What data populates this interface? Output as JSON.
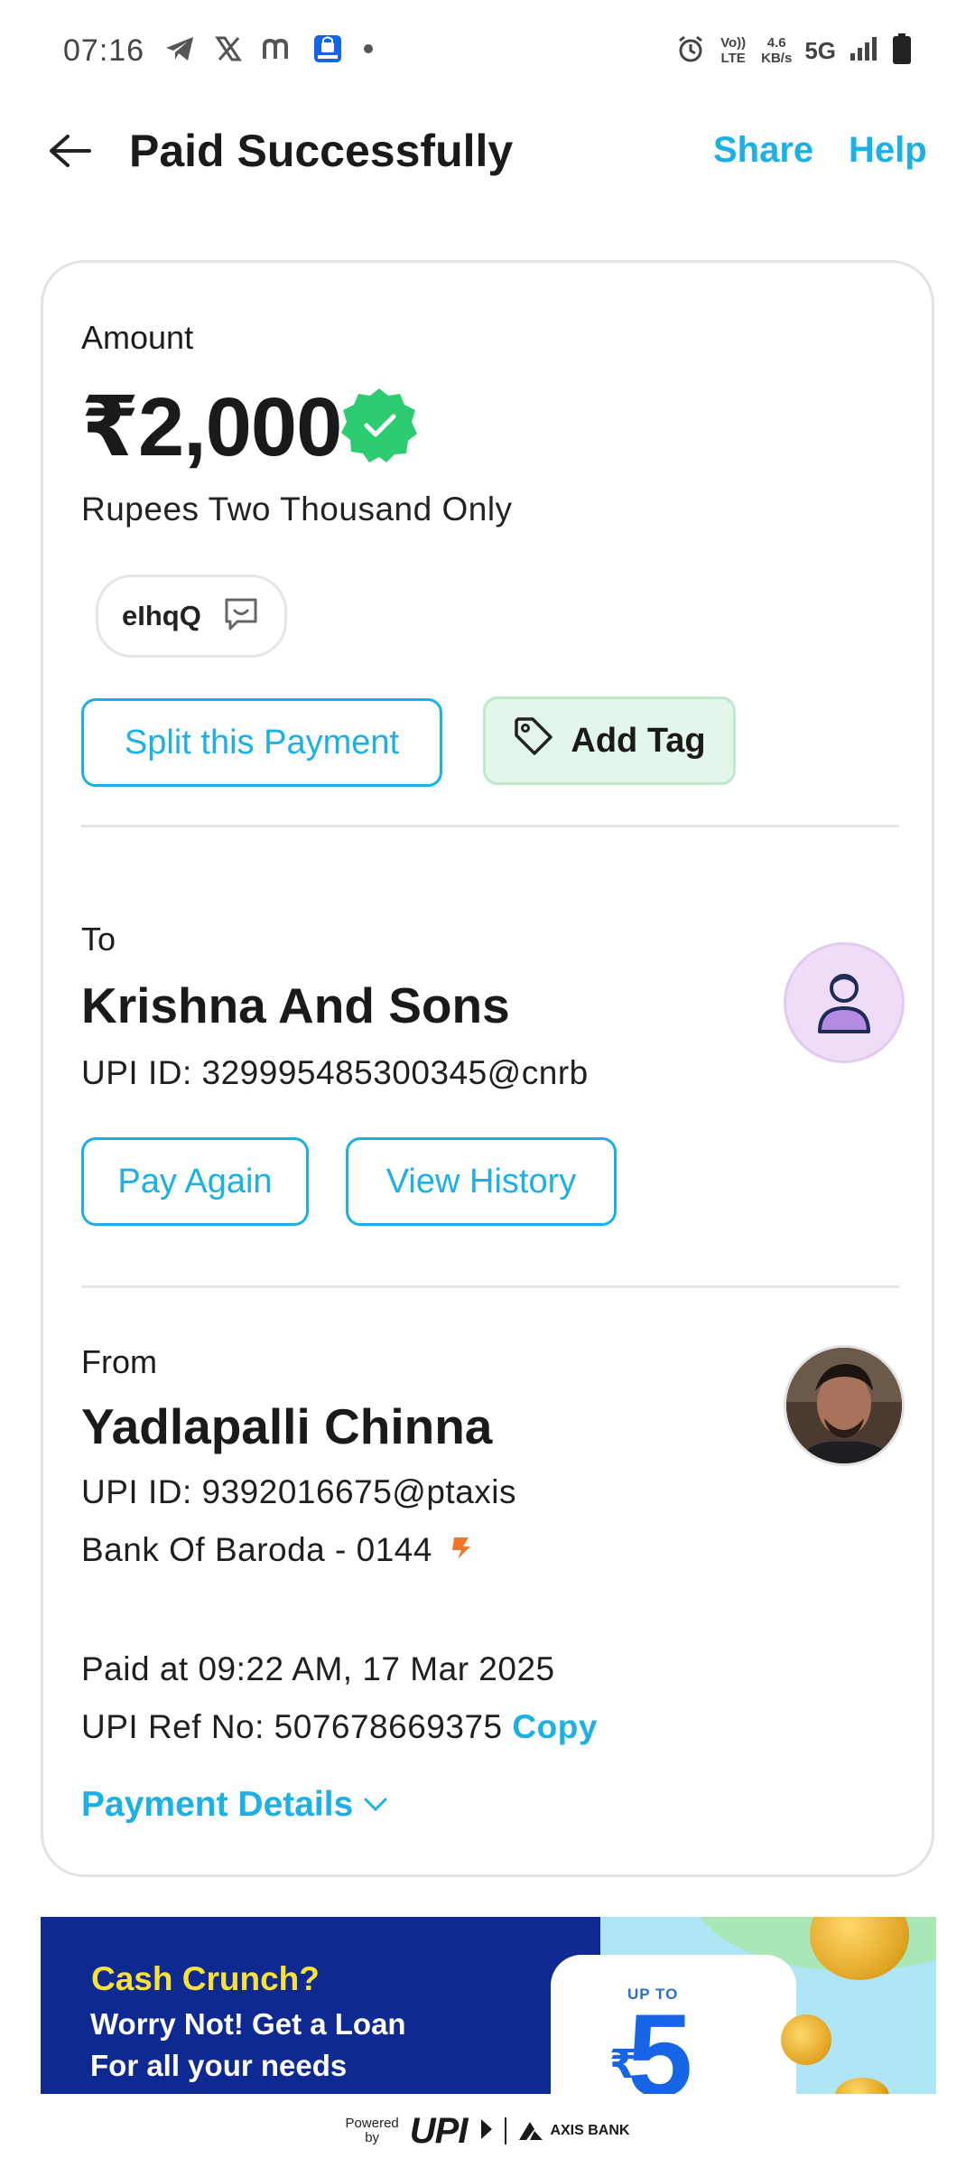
{
  "status_bar": {
    "time": "07:16",
    "network_speed_value": "4.6",
    "network_speed_unit": "KB/s",
    "volte": "Vo)) LTE",
    "network_type": "5G",
    "icons": [
      "telegram-icon",
      "x-icon",
      "m-app-icon",
      "lock-app-icon",
      "dot-icon",
      "alarm-icon",
      "signal-icon",
      "battery-icon"
    ]
  },
  "header": {
    "title": "Paid Successfully",
    "share_label": "Share",
    "help_label": "Help"
  },
  "amount_section": {
    "label": "Amount",
    "value": "₹2,000",
    "in_words": "Rupees Two Thousand Only",
    "note": "eIhqQ",
    "split_button": "Split this Payment",
    "tag_button": "Add Tag"
  },
  "to_section": {
    "label": "To",
    "name": "Krishna And Sons",
    "upi_id": "UPI ID: 329995485300345@cnrb",
    "pay_again_button": "Pay Again",
    "view_history_button": "View History"
  },
  "from_section": {
    "label": "From",
    "name": "Yadlapalli Chinna",
    "upi_id": "UPI ID: 9392016675@ptaxis",
    "bank": "Bank Of Baroda - 0144",
    "paid_at": "Paid at 09:22 AM, 17 Mar 2025",
    "ref_no": "UPI Ref No: 507678669375",
    "copy_label": "Copy",
    "details_label": "Payment Details"
  },
  "banner": {
    "title": "Cash Crunch?",
    "line1": "Worry Not! Get a Loan",
    "line2": "For all your needs",
    "upto": "UP TO",
    "amount_symbol": "₹",
    "amount_value": "5"
  },
  "footer": {
    "powered_line1": "Powered",
    "powered_line2": "by",
    "upi_text": "UPI",
    "bank_text": "AXIS BANK"
  },
  "colors": {
    "accent": "#1bb0e6",
    "verified_green": "#2ecc71",
    "tag_bg": "#e3f6ea",
    "banner_bg": "#0e2a92",
    "banner_title": "#f7e23a"
  }
}
